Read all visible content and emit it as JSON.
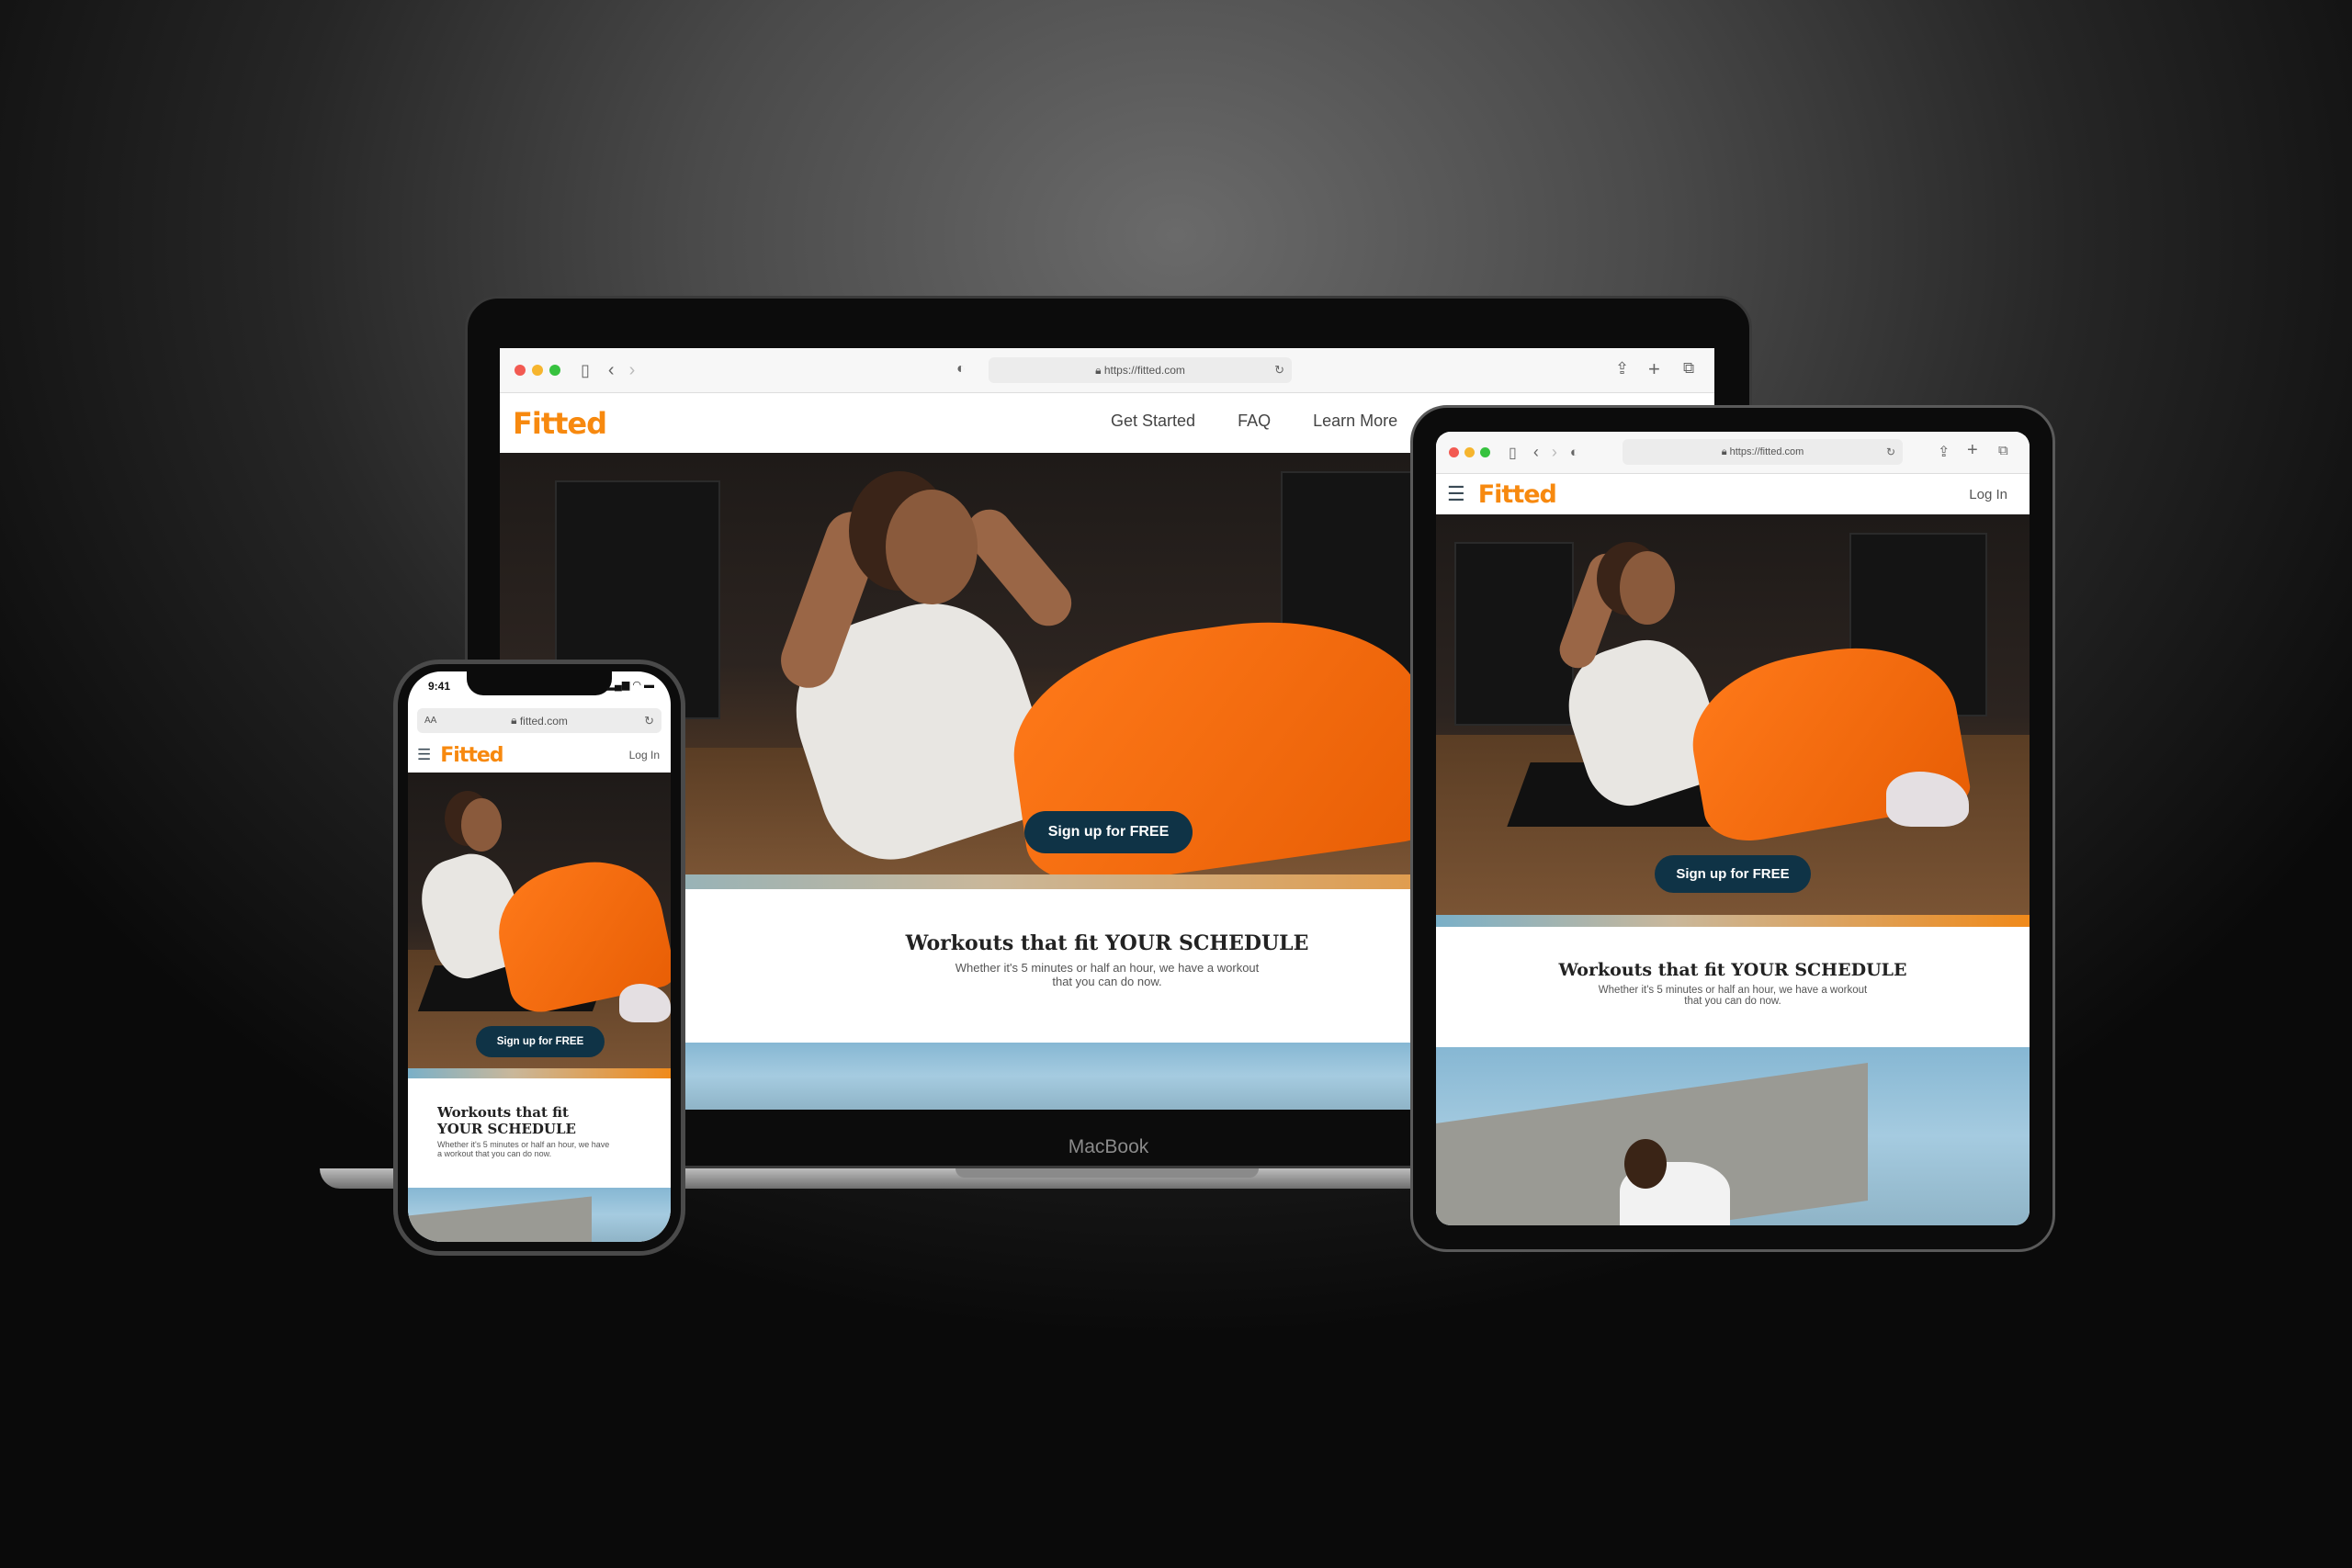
{
  "brand": {
    "name": "Fitted",
    "color": "#f7890f",
    "cta_color": "#0f3346"
  },
  "laptop": {
    "label": "MacBook",
    "browser": {
      "url": "https://fitted.com"
    },
    "nav": [
      "Get Started",
      "FAQ",
      "Learn More"
    ],
    "cta": "Sign up for FREE",
    "headline": "Workouts that fit YOUR SCHEDULE",
    "subtext_line1": "Whether it's 5 minutes or half an hour, we have a workout",
    "subtext_line2": "that you can do now."
  },
  "tablet": {
    "browser": {
      "url": "https://fitted.com"
    },
    "login": "Log In",
    "cta": "Sign up for FREE",
    "headline": "Workouts that fit YOUR SCHEDULE",
    "subtext_line1": "Whether it's 5 minutes or half an hour, we have a workout",
    "subtext_line2": "that you can do now."
  },
  "phone": {
    "time": "9:41",
    "text_size": "AA",
    "url": "fitted.com",
    "login": "Log In",
    "cta": "Sign up for FREE",
    "headline_line1": "Workouts that fit",
    "headline_line2": "YOUR SCHEDULE",
    "subtext_line1": "Whether it's 5 minutes or half an hour, we have",
    "subtext_line2": "a workout that you can do now."
  }
}
